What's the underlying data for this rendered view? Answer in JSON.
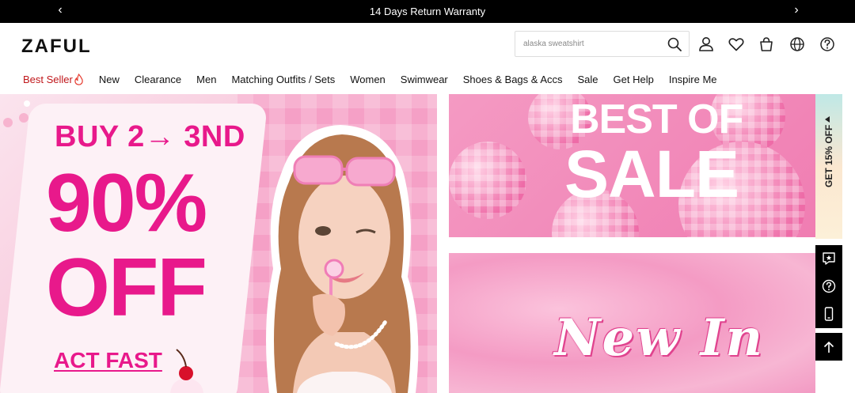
{
  "topbar": {
    "message": "14 Days Return Warranty",
    "prev_icon": "chevron-left-icon",
    "next_icon": "chevron-right-icon",
    "prev_glyph": "‹",
    "next_glyph": "›"
  },
  "header": {
    "logo": "ZAFUL",
    "search": {
      "placeholder": "alaska sweatshirt",
      "value": ""
    },
    "icons": [
      "search-icon",
      "account-icon",
      "wishlist-heart-icon",
      "shopping-bag-icon",
      "globe-icon",
      "help-icon"
    ]
  },
  "nav": {
    "items": [
      {
        "label": "Best Seller"
      },
      {
        "label": "New"
      },
      {
        "label": "Clearance"
      },
      {
        "label": "Men"
      },
      {
        "label": "Matching Outfits / Sets"
      },
      {
        "label": "Women"
      },
      {
        "label": "Swimwear"
      },
      {
        "label": "Shoes & Bags & Accs"
      },
      {
        "label": "Sale"
      },
      {
        "label": "Get Help"
      },
      {
        "label": "Inspire Me"
      }
    ],
    "hot_color": "#c0171b"
  },
  "banners": {
    "left": {
      "line1": "BUY 2→ 3ND",
      "line2": "90%",
      "line3": "OFF",
      "cta": "ACT FAST",
      "accent": "#e8198b"
    },
    "right_top": {
      "line1": "BEST OF",
      "line2": "SALE"
    },
    "right_bottom": {
      "title": "New In"
    }
  },
  "side": {
    "coupon_label": "GET 15% OFF",
    "buttons": [
      "review-star-icon",
      "help-icon",
      "mobile-app-icon"
    ],
    "back_to_top": "arrow-up-icon"
  }
}
